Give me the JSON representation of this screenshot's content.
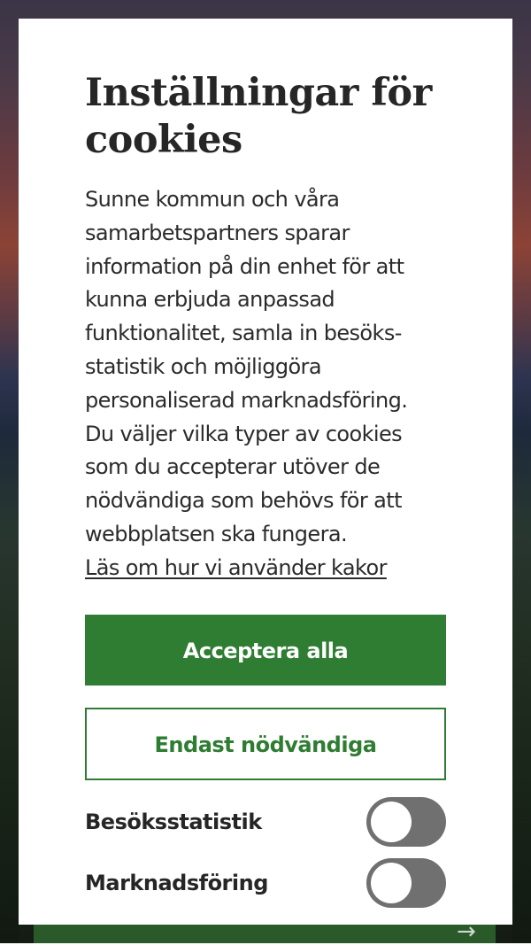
{
  "dialog": {
    "title_line1": "Inställningar för",
    "title_line2": "cookies",
    "body_lines": [
      "Sunne kommun och våra",
      "samarbetspartners sparar",
      "information på din enhet för att",
      "kunna erbjuda anpassad",
      "funktionalitet, samla in besöks-",
      "statistik och möjliggöra",
      "personaliserad marknadsföring.",
      "Du väljer vilka typer av cookies",
      "som du accepterar utöver de",
      "nödvändiga som behövs för att",
      "webbplatsen ska fungera."
    ],
    "link_label": "Läs om hur vi använder kakor",
    "accept_all_label": "Acceptera alla",
    "necessary_only_label": "Endast nödvändiga",
    "toggles": [
      {
        "label": "Besöksstatistik",
        "enabled": false
      },
      {
        "label": "Marknadsföring",
        "enabled": false
      }
    ]
  },
  "colors": {
    "accent_green": "#2e7d32",
    "toggle_off": "#707070",
    "text_dark": "#262626"
  },
  "icons": {
    "background_arrow": "arrow-right-icon"
  },
  "background_arrow_glyph": "→"
}
